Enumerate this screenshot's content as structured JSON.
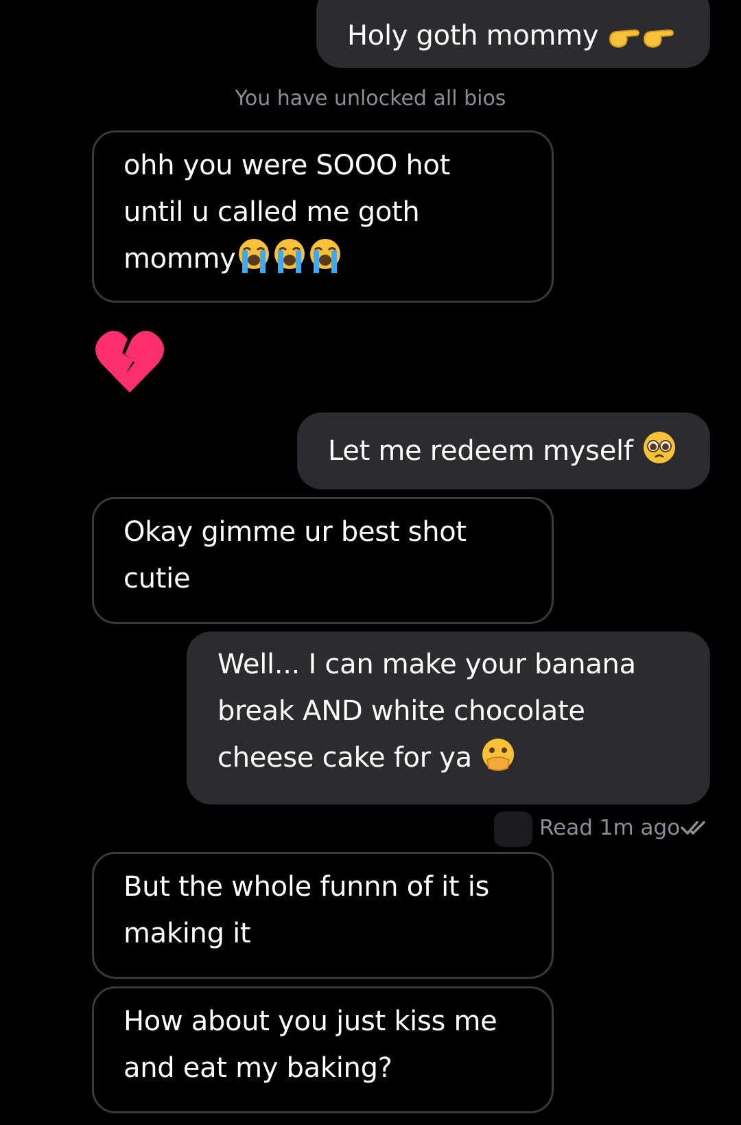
{
  "conversation": {
    "system_note": "You have unlocked all bios",
    "read_receipt": {
      "text": "Read 1m ago",
      "icon": "double-check-icon"
    },
    "messages": [
      {
        "direction": "sent",
        "text": "Holy goth mommy",
        "emoji": [
          "backhand-pointing-right",
          "backhand-pointing-right"
        ]
      },
      {
        "direction": "received",
        "text": "ohh you were SOOO hot\nuntil u called me goth\nmommy",
        "emoji": [
          "loudly-crying-face",
          "loudly-crying-face",
          "loudly-crying-face"
        ]
      },
      {
        "direction": "received",
        "text": "",
        "emoji": [
          "broken-heart"
        ]
      },
      {
        "direction": "sent",
        "text": "Let me redeem myself",
        "emoji": [
          "pleading-face"
        ]
      },
      {
        "direction": "received",
        "text": "Okay gimme ur best shot\ncutie"
      },
      {
        "direction": "sent",
        "text": "Well... I can make your banana\nbreak AND white chocolate\ncheese cake for ya",
        "emoji": [
          "face-with-open-eyes-and-hand-over-mouth"
        ]
      },
      {
        "direction": "received",
        "text": "But the whole funnn of it is\nmaking it"
      },
      {
        "direction": "received",
        "text": "How about you just kiss me\nand eat my baking?"
      }
    ]
  },
  "colors": {
    "background": "#000000",
    "sent_bubble": "#2c2c2e",
    "received_border": "#3a3a3c",
    "muted_text": "#8e8e93",
    "text": "#ffffff"
  }
}
